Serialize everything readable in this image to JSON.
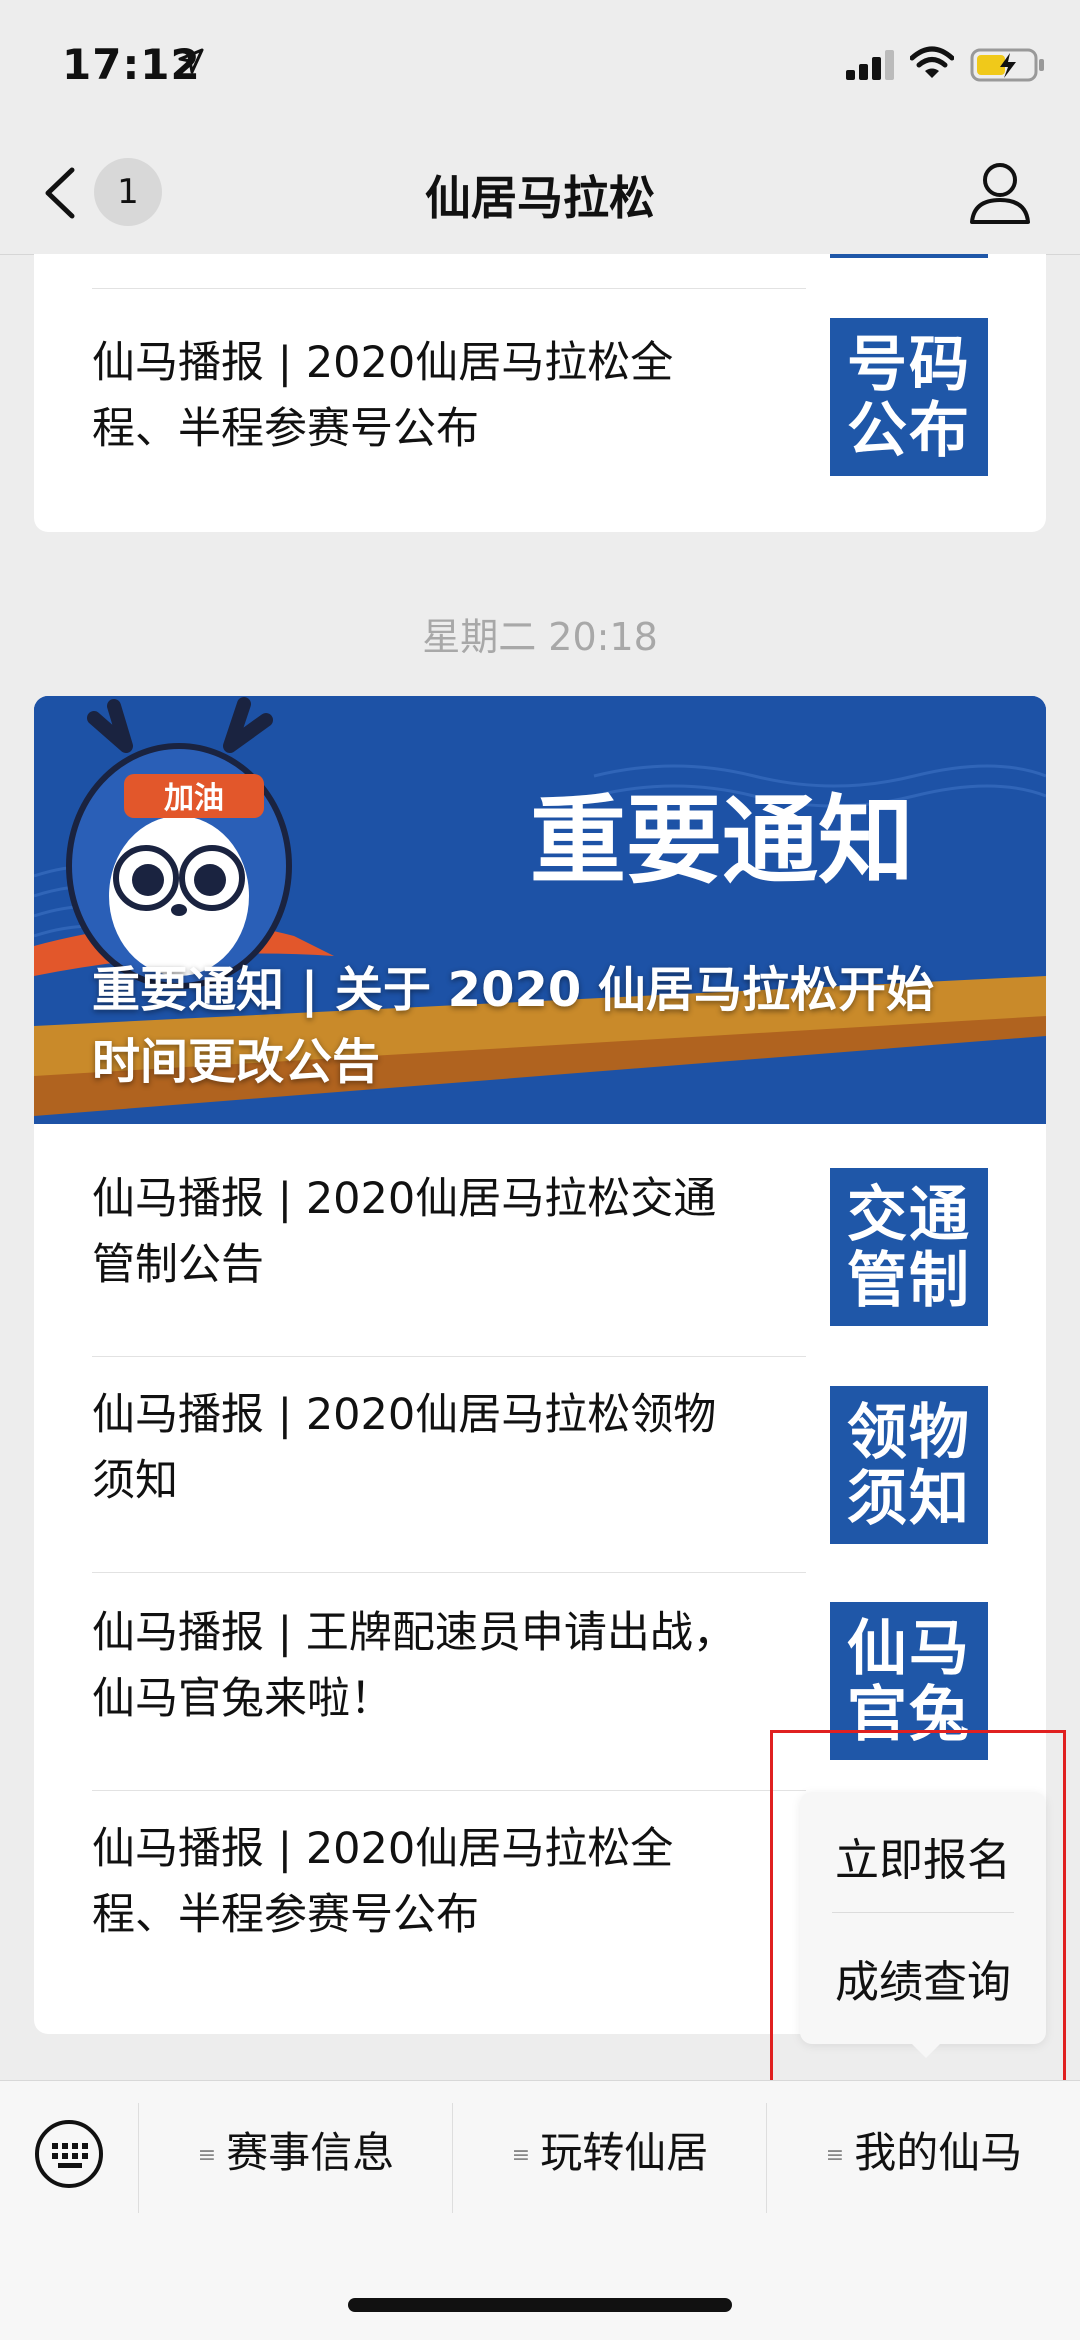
{
  "status": {
    "time": "17:12"
  },
  "nav": {
    "back_badge": "1",
    "title": "仙居马拉松"
  },
  "card1": {
    "article": {
      "title_line1": "仙马播报 | 2020仙居马拉松全",
      "title_line2": "程、半程参赛号公布",
      "thumb_line1": "号码",
      "thumb_line2": "公布"
    }
  },
  "timestamp": "星期二 20:18",
  "card2": {
    "hero": {
      "art_text": "重要通知",
      "headband_text": "加油",
      "caption_line1": "重要通知 | 关于 2020 仙居马拉松开始",
      "caption_line2": "时间更改公告"
    },
    "articles": [
      {
        "title_line1": "仙马播报 | 2020仙居马拉松交通",
        "title_line2": "管制公告",
        "thumb_line1": "交通",
        "thumb_line2": "管制"
      },
      {
        "title_line1": "仙马播报 | 2020仙居马拉松领物",
        "title_line2": "须知",
        "thumb_line1": "领物",
        "thumb_line2": "须知"
      },
      {
        "title_line1": "仙马播报 | 王牌配速员申请出战，",
        "title_line2": "仙马官兔来啦！",
        "thumb_line1": "仙马",
        "thumb_line2": "官兔"
      },
      {
        "title_line1": "仙马播报 | 2020仙居马拉松全",
        "title_line2": "程、半程参赛号公布"
      }
    ]
  },
  "popup": {
    "items": [
      "立即报名",
      "成绩查询"
    ]
  },
  "menubar": {
    "items": [
      "赛事信息",
      "玩转仙居",
      "我的仙马"
    ]
  },
  "colors": {
    "brand_blue": "#1f57a8",
    "highlight_red": "#e02020"
  }
}
